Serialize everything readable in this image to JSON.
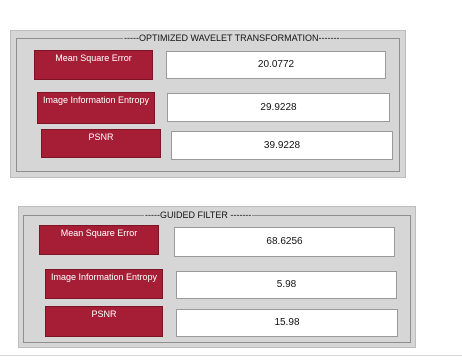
{
  "panels": [
    {
      "title": "-----OPTIMIZED WAVELET TRANSFORMATION-------",
      "rows": [
        {
          "label": "Mean Square Error",
          "value": "20.0772"
        },
        {
          "label": "Image Information Entropy",
          "value": "29.9228"
        },
        {
          "label": "PSNR",
          "value": "39.9228"
        }
      ]
    },
    {
      "title": "-----GUIDED FILTER -------",
      "rows": [
        {
          "label": "Mean Square Error",
          "value": "68.6256"
        },
        {
          "label": "Image Information Entropy",
          "value": "5.98"
        },
        {
          "label": "PSNR",
          "value": "15.98"
        }
      ]
    }
  ],
  "colors": {
    "label_fill": "#a51e36",
    "panel_fill": "#d6d6d6",
    "value_fill": "#ffffff"
  }
}
